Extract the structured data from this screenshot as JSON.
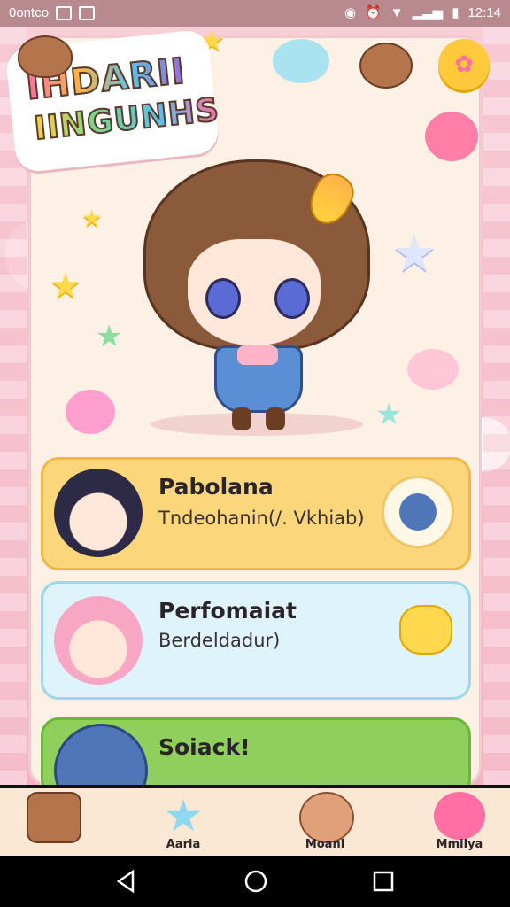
{
  "status_bar": {
    "carrier": "0ontco",
    "time": "12:14"
  },
  "logo": {
    "line1": "IHDARII",
    "line2": "IINGUNHS"
  },
  "cards": [
    {
      "title": "Pabolana",
      "subtitle": "Tndeohanin(/. Vkhiab)"
    },
    {
      "title": "Perfomaiat",
      "subtitle": "Berdeldadur)"
    },
    {
      "title": "Soiack!",
      "subtitle": ""
    }
  ],
  "nav": [
    {
      "label": ""
    },
    {
      "label": "Aaria"
    },
    {
      "label": "Moanl"
    },
    {
      "label": "Mmilya"
    }
  ]
}
